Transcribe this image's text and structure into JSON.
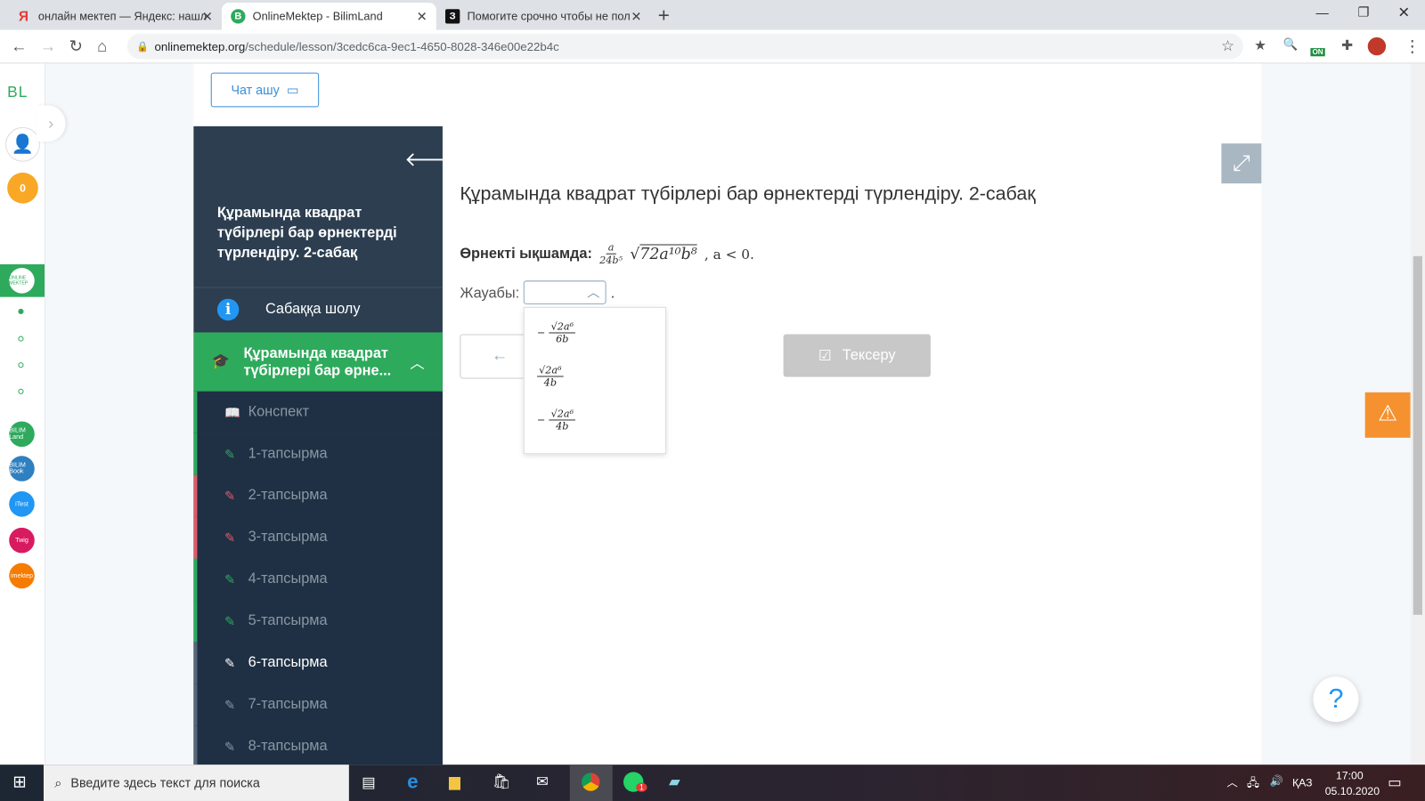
{
  "browser": {
    "tabs": [
      {
        "label": "онлайн мектеп — Яндекс: нашл",
        "icon": "yandex-icon",
        "color": "#e53935",
        "glyph": "Я"
      },
      {
        "label": "OnlineMektep - BilimLand",
        "icon": "bilimland-icon",
        "color": "#2eaa5c",
        "glyph": "B",
        "active": true
      },
      {
        "label": "Помогите срочно чтобы не пол",
        "icon": "znanija-icon",
        "color": "#111111",
        "glyph": "З"
      }
    ],
    "new_tab": "+",
    "url_host": "onlinemektep.org",
    "url_path": "/schedule/lesson/3cedc6ca-9ec1-4650-8028-346e00e22b4c",
    "extension_badge": "ON"
  },
  "leftbar": {
    "logo": "BL",
    "points": "0",
    "apps": [
      "ONLINE MEKTEP",
      "BILIM Land",
      "BILIM Book",
      "iTest",
      "Twig",
      "imektep"
    ]
  },
  "chat_button": "Чат ашу",
  "lesson_sidebar": {
    "title": "Құрамында квадрат түбірлері бар өрнектерді түрлендіру. 2-сабақ",
    "overview": "Сабаққа шолу",
    "current_section": "Құрамында квадрат түбірлері бар өрне...",
    "items": [
      {
        "label": "Конспект",
        "status": "done",
        "color": "#2eaa5c"
      },
      {
        "label": "1-тапсырма",
        "status": "correct",
        "color": "#2eaa5c"
      },
      {
        "label": "2-тапсырма",
        "status": "wrong",
        "color": "#e05a6a"
      },
      {
        "label": "3-тапсырма",
        "status": "wrong",
        "color": "#e05a6a"
      },
      {
        "label": "4-тапсырма",
        "status": "correct",
        "color": "#2eaa5c"
      },
      {
        "label": "5-тапсырма",
        "status": "correct",
        "color": "#2eaa5c"
      },
      {
        "label": "6-тапсырма",
        "status": "active",
        "color": "#ffffff"
      },
      {
        "label": "7-тапсырма",
        "status": "pending",
        "color": "#8a96a3"
      },
      {
        "label": "8-тапсырма",
        "status": "pending",
        "color": "#8a96a3"
      }
    ]
  },
  "main": {
    "title": "Құрамында квадрат түбірлері бар өрнектерді түрлендіру. 2-сабақ",
    "prompt": "Өрнекті ықшамда:",
    "expr_num": "a",
    "expr_den": "24b⁵",
    "expr_root": "72a¹⁰b⁸",
    "expr_cond": ", a < 0.",
    "answer_label": "Жауабы:",
    "answer_value": "",
    "options": [
      {
        "sign": "−",
        "num": "√2a⁶",
        "den": "6b"
      },
      {
        "sign": "",
        "num": "√2a⁶",
        "den": "4b"
      },
      {
        "sign": "−",
        "num": "√2a⁶",
        "den": "4b"
      }
    ],
    "check_button": "Тексеру"
  },
  "taskbar": {
    "search_placeholder": "Введите здесь текст для поиска",
    "lang": "ҚАЗ",
    "time": "17:00",
    "date": "05.10.2020",
    "whatsapp_badge": "1"
  },
  "colors": {
    "accent": "#2eaa5c",
    "sidebar": "#2c3e50",
    "warning": "#f5922f",
    "check_disabled": "#c8c8c8"
  }
}
